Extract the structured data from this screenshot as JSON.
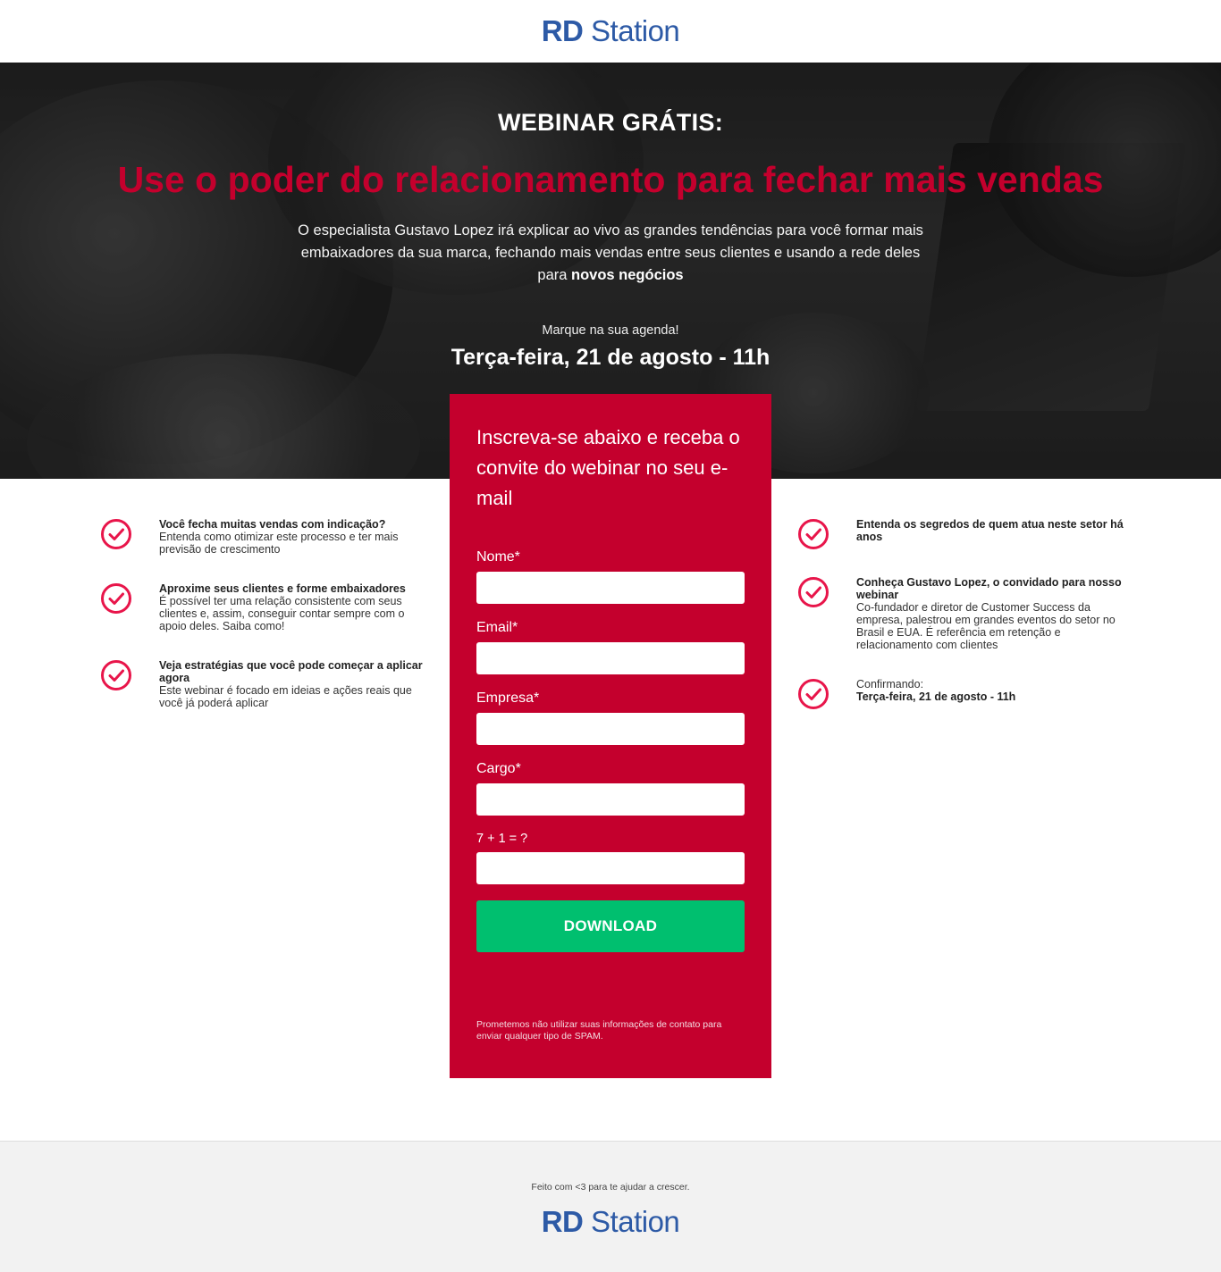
{
  "brand": {
    "logo_bold": "RD",
    "logo_light": " Station",
    "color": "#2d5aa6"
  },
  "hero": {
    "eyebrow": "WEBINAR GRÁTIS:",
    "headline": "Use o poder do relacionamento para fechar mais vendas",
    "lead_text": "O especialista Gustavo Lopez irá explicar ao vivo as grandes tendências para você formar mais embaixadores da sua marca, fechando mais vendas entre seus clientes e usando a rede deles para ",
    "lead_bold": "novos negócios",
    "agenda_label": "Marque na sua agenda!",
    "agenda_date": "Terça-feira, 21 de agosto - 11h",
    "accent_color": "#c4002d"
  },
  "form": {
    "title": "Inscreva-se abaixo e receba o convite do webinar no seu e-mail",
    "fields": [
      {
        "label": "Nome*",
        "value": ""
      },
      {
        "label": "Email*",
        "value": ""
      },
      {
        "label": "Empresa*",
        "value": ""
      },
      {
        "label": "Cargo*",
        "value": ""
      },
      {
        "label": "7 + 1 = ?",
        "value": ""
      }
    ],
    "submit_label": "DOWNLOAD",
    "submit_color": "#00bf6f",
    "privacy": "Prometemos não utilizar suas informações de contato para enviar qualquer tipo de SPAM."
  },
  "benefits_left": [
    {
      "title": "Você fecha muitas vendas com indicação?",
      "desc": "Entenda como otimizar este processo e ter mais previsão de crescimento",
      "icon": "check-circle-icon"
    },
    {
      "title": "Aproxime seus clientes e forme embaixadores",
      "desc": "É possível ter uma relação consistente com seus clientes e, assim, conseguir contar sempre com o apoio deles. Saiba como!",
      "icon": "check-circle-icon"
    },
    {
      "title": "Veja estratégias que você pode começar a aplicar agora",
      "desc": "Este webinar é focado em ideias e ações reais que você já poderá aplicar",
      "icon": "check-circle-icon"
    }
  ],
  "benefits_right": [
    {
      "title": "Entenda os segredos de quem atua neste setor há anos",
      "desc": "",
      "icon": "check-circle-icon"
    },
    {
      "title": "Conheça Gustavo Lopez, o convidado para nosso webinar",
      "desc": "Co-fundador e diretor de Customer Success da empresa, palestrou em grandes eventos do setor no Brasil e EUA. É referência em retenção e relacionamento com clientes",
      "icon": "check-circle-icon"
    },
    {
      "desc": "Confirmando:",
      "title": "Terça-feira, 21 de agosto - 11h",
      "icon": "check-circle-icon"
    }
  ],
  "footer": {
    "made_with": "Feito com <3 para te ajudar a crescer."
  }
}
